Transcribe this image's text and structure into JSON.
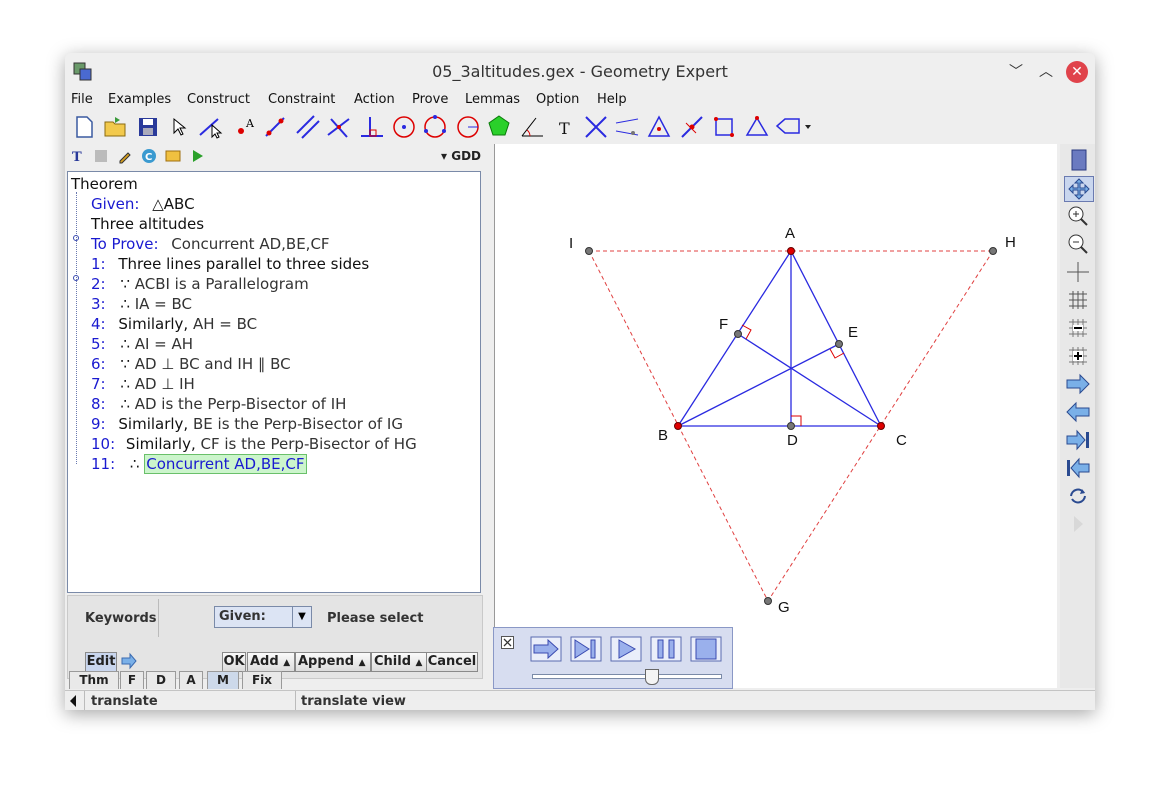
{
  "window": {
    "title": "05_3altitudes.gex - Geometry Expert"
  },
  "menu": [
    "File",
    "Examples",
    "Construct",
    "Constraint",
    "Action",
    "Prove",
    "Lemmas",
    "Option",
    "Help"
  ],
  "left_panel": {
    "mode": "GDD",
    "tree": {
      "root": "Theorem",
      "given_label": "Given:",
      "given_value": "ABC",
      "title": "Three altitudes",
      "to_prove_label": "To Prove:",
      "to_prove_value": "Concurrent AD,BE,CF",
      "steps": [
        {
          "num": "1:",
          "text": "Three lines parallel to three sides"
        },
        {
          "num": "2:",
          "text": "ACBI is a Parallelogram"
        },
        {
          "num": "3:",
          "text": "IA = BC"
        },
        {
          "num": "4:",
          "prefix": "Similarly,",
          "text": "AH = BC"
        },
        {
          "num": "5:",
          "text": "AI = AH"
        },
        {
          "num": "6:",
          "text": "AD ⊥ BC and IH ∥ BC"
        },
        {
          "num": "7:",
          "text": "AD ⊥ IH"
        },
        {
          "num": "8:",
          "text": "AD is the Perp-Bisector of IH"
        },
        {
          "num": "9:",
          "prefix": "Similarly,",
          "text": "BE is the Perp-Bisector of IG"
        },
        {
          "num": "10:",
          "prefix": "Similarly,",
          "text": "CF is the Perp-Bisector of HG"
        },
        {
          "num": "11:",
          "text": "Concurrent AD,BE,CF"
        }
      ]
    },
    "keywords": {
      "label": "Keywords",
      "select_value": "Given:",
      "hint": "Please select"
    },
    "buttons": {
      "edit": "Edit",
      "ok": "OK",
      "add": "Add",
      "append": "Append",
      "child": "Child",
      "cancel": "Cancel"
    },
    "tabs": [
      "Thm",
      "F",
      "D",
      "A",
      "M",
      "Fix"
    ],
    "active_tab": "M"
  },
  "canvas": {
    "points": [
      "A",
      "B",
      "C",
      "D",
      "E",
      "F",
      "G",
      "H",
      "I"
    ],
    "colors": {
      "lines": "#2a2ae0",
      "dashed": "#e02a2a",
      "point_fixed": "#e00000",
      "point_free": "#666666"
    }
  },
  "animation": {
    "slider_percent": 63
  },
  "status": {
    "left": "translate",
    "right": "translate view"
  }
}
